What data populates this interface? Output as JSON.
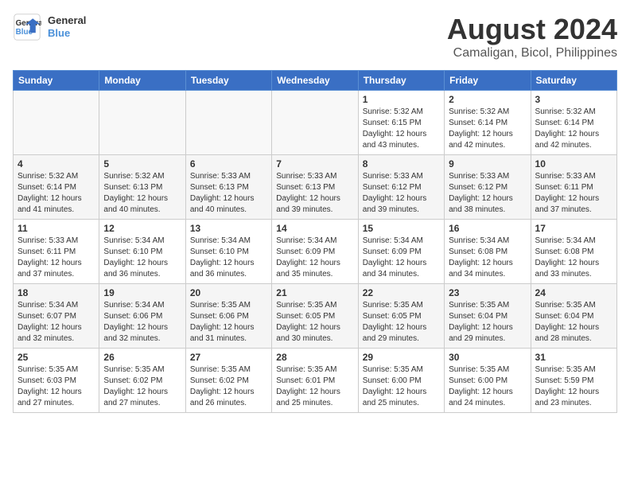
{
  "header": {
    "logo_line1": "General",
    "logo_line2": "Blue",
    "month": "August 2024",
    "location": "Camaligan, Bicol, Philippines"
  },
  "weekdays": [
    "Sunday",
    "Monday",
    "Tuesday",
    "Wednesday",
    "Thursday",
    "Friday",
    "Saturday"
  ],
  "weeks": [
    [
      {
        "day": "",
        "info": ""
      },
      {
        "day": "",
        "info": ""
      },
      {
        "day": "",
        "info": ""
      },
      {
        "day": "",
        "info": ""
      },
      {
        "day": "1",
        "info": "Sunrise: 5:32 AM\nSunset: 6:15 PM\nDaylight: 12 hours\nand 43 minutes."
      },
      {
        "day": "2",
        "info": "Sunrise: 5:32 AM\nSunset: 6:14 PM\nDaylight: 12 hours\nand 42 minutes."
      },
      {
        "day": "3",
        "info": "Sunrise: 5:32 AM\nSunset: 6:14 PM\nDaylight: 12 hours\nand 42 minutes."
      }
    ],
    [
      {
        "day": "4",
        "info": "Sunrise: 5:32 AM\nSunset: 6:14 PM\nDaylight: 12 hours\nand 41 minutes."
      },
      {
        "day": "5",
        "info": "Sunrise: 5:32 AM\nSunset: 6:13 PM\nDaylight: 12 hours\nand 40 minutes."
      },
      {
        "day": "6",
        "info": "Sunrise: 5:33 AM\nSunset: 6:13 PM\nDaylight: 12 hours\nand 40 minutes."
      },
      {
        "day": "7",
        "info": "Sunrise: 5:33 AM\nSunset: 6:13 PM\nDaylight: 12 hours\nand 39 minutes."
      },
      {
        "day": "8",
        "info": "Sunrise: 5:33 AM\nSunset: 6:12 PM\nDaylight: 12 hours\nand 39 minutes."
      },
      {
        "day": "9",
        "info": "Sunrise: 5:33 AM\nSunset: 6:12 PM\nDaylight: 12 hours\nand 38 minutes."
      },
      {
        "day": "10",
        "info": "Sunrise: 5:33 AM\nSunset: 6:11 PM\nDaylight: 12 hours\nand 37 minutes."
      }
    ],
    [
      {
        "day": "11",
        "info": "Sunrise: 5:33 AM\nSunset: 6:11 PM\nDaylight: 12 hours\nand 37 minutes."
      },
      {
        "day": "12",
        "info": "Sunrise: 5:34 AM\nSunset: 6:10 PM\nDaylight: 12 hours\nand 36 minutes."
      },
      {
        "day": "13",
        "info": "Sunrise: 5:34 AM\nSunset: 6:10 PM\nDaylight: 12 hours\nand 36 minutes."
      },
      {
        "day": "14",
        "info": "Sunrise: 5:34 AM\nSunset: 6:09 PM\nDaylight: 12 hours\nand 35 minutes."
      },
      {
        "day": "15",
        "info": "Sunrise: 5:34 AM\nSunset: 6:09 PM\nDaylight: 12 hours\nand 34 minutes."
      },
      {
        "day": "16",
        "info": "Sunrise: 5:34 AM\nSunset: 6:08 PM\nDaylight: 12 hours\nand 34 minutes."
      },
      {
        "day": "17",
        "info": "Sunrise: 5:34 AM\nSunset: 6:08 PM\nDaylight: 12 hours\nand 33 minutes."
      }
    ],
    [
      {
        "day": "18",
        "info": "Sunrise: 5:34 AM\nSunset: 6:07 PM\nDaylight: 12 hours\nand 32 minutes."
      },
      {
        "day": "19",
        "info": "Sunrise: 5:34 AM\nSunset: 6:06 PM\nDaylight: 12 hours\nand 32 minutes."
      },
      {
        "day": "20",
        "info": "Sunrise: 5:35 AM\nSunset: 6:06 PM\nDaylight: 12 hours\nand 31 minutes."
      },
      {
        "day": "21",
        "info": "Sunrise: 5:35 AM\nSunset: 6:05 PM\nDaylight: 12 hours\nand 30 minutes."
      },
      {
        "day": "22",
        "info": "Sunrise: 5:35 AM\nSunset: 6:05 PM\nDaylight: 12 hours\nand 29 minutes."
      },
      {
        "day": "23",
        "info": "Sunrise: 5:35 AM\nSunset: 6:04 PM\nDaylight: 12 hours\nand 29 minutes."
      },
      {
        "day": "24",
        "info": "Sunrise: 5:35 AM\nSunset: 6:04 PM\nDaylight: 12 hours\nand 28 minutes."
      }
    ],
    [
      {
        "day": "25",
        "info": "Sunrise: 5:35 AM\nSunset: 6:03 PM\nDaylight: 12 hours\nand 27 minutes."
      },
      {
        "day": "26",
        "info": "Sunrise: 5:35 AM\nSunset: 6:02 PM\nDaylight: 12 hours\nand 27 minutes."
      },
      {
        "day": "27",
        "info": "Sunrise: 5:35 AM\nSunset: 6:02 PM\nDaylight: 12 hours\nand 26 minutes."
      },
      {
        "day": "28",
        "info": "Sunrise: 5:35 AM\nSunset: 6:01 PM\nDaylight: 12 hours\nand 25 minutes."
      },
      {
        "day": "29",
        "info": "Sunrise: 5:35 AM\nSunset: 6:00 PM\nDaylight: 12 hours\nand 25 minutes."
      },
      {
        "day": "30",
        "info": "Sunrise: 5:35 AM\nSunset: 6:00 PM\nDaylight: 12 hours\nand 24 minutes."
      },
      {
        "day": "31",
        "info": "Sunrise: 5:35 AM\nSunset: 5:59 PM\nDaylight: 12 hours\nand 23 minutes."
      }
    ]
  ]
}
